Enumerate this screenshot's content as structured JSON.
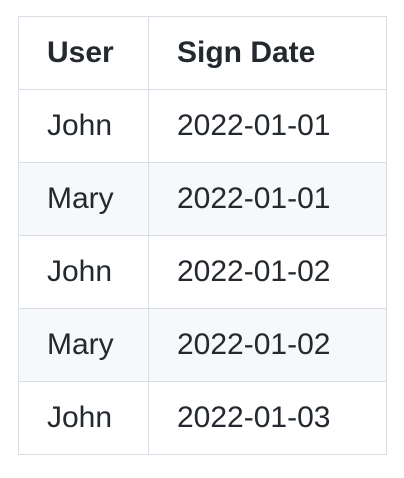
{
  "table": {
    "headers": {
      "user": "User",
      "sign_date": "Sign Date"
    },
    "rows": [
      {
        "user": "John",
        "sign_date": "2022-01-01"
      },
      {
        "user": "Mary",
        "sign_date": "2022-01-01"
      },
      {
        "user": "John",
        "sign_date": "2022-01-02"
      },
      {
        "user": "Mary",
        "sign_date": "2022-01-02"
      },
      {
        "user": "John",
        "sign_date": "2022-01-03"
      }
    ]
  },
  "colors": {
    "border": "#d8dee4",
    "text": "#24292f",
    "alt_row_bg": "#f6f8fa"
  }
}
